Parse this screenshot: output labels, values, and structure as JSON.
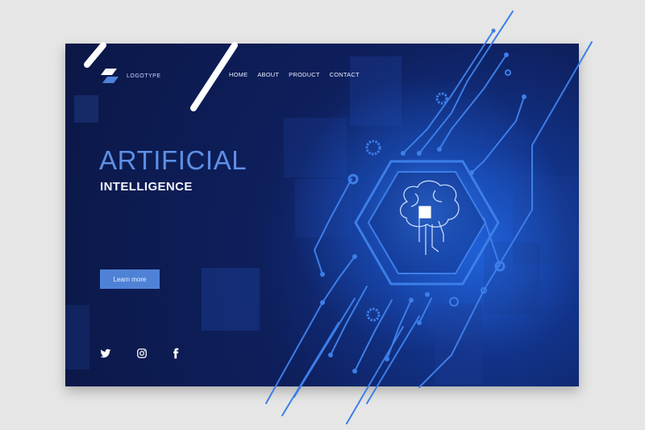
{
  "logo": {
    "text": "LOGOTYPE"
  },
  "nav": {
    "items": [
      "HOME",
      "ABOUT",
      "PRODUCT",
      "CONTACT"
    ]
  },
  "hero": {
    "title": "ARTIFICIAL",
    "subtitle": "INTELLIGENCE",
    "cta_label": "Learn more"
  },
  "social": {
    "icons": [
      "twitter-icon",
      "instagram-icon",
      "facebook-icon"
    ]
  },
  "colors": {
    "background": "#e6e6e6",
    "page_dark": "#0b1746",
    "glow": "#1f5fd6",
    "accent": "#4f82d6",
    "title": "#5d8fe6",
    "circuit": "#3d7ee8"
  },
  "illustration": {
    "icon": "brain-chip-icon"
  }
}
